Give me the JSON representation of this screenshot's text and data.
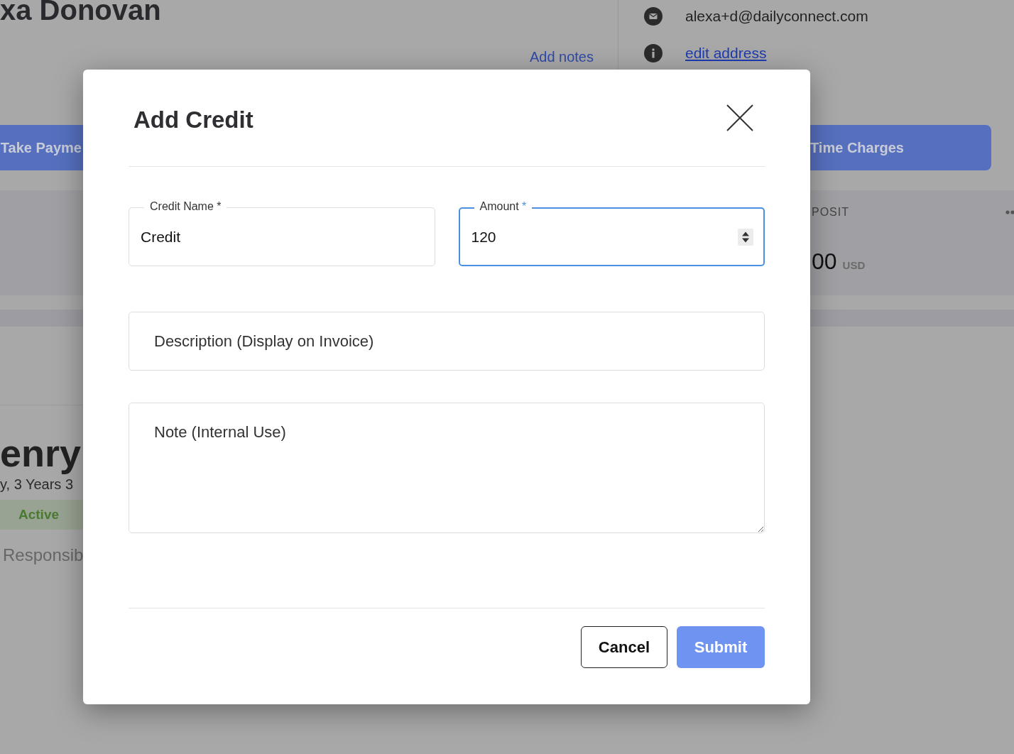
{
  "background": {
    "customer_name": "xa Donovan",
    "add_notes_link": "Add notes",
    "contacts": [
      {
        "kind": "email",
        "text": "alexa+d@dailyconnect.com"
      },
      {
        "kind": "info",
        "text": "edit address"
      }
    ],
    "take_payment_button": "Take Payme",
    "time_charges_button": "Time Charges",
    "deposit_card": {
      "label": "POSIT",
      "amount": "00",
      "currency": "USD"
    },
    "child": {
      "name": "enry",
      "age": "y, 3 Years 3",
      "status": "Active",
      "role": "Responsib"
    }
  },
  "dialog": {
    "title": "Add Credit",
    "fields": [
      {
        "kind": "text",
        "label": "Credit Name",
        "required_mark": "*",
        "value": "Credit",
        "focused": false
      },
      {
        "kind": "number",
        "label": "Amount",
        "required_mark": "*",
        "value": "120",
        "focused": true
      },
      {
        "kind": "text",
        "placeholder": "Description (Display on Invoice)"
      },
      {
        "kind": "textarea",
        "placeholder": "Note (Internal Use)"
      }
    ],
    "buttons": [
      {
        "kind": "secondary",
        "label": "Cancel"
      },
      {
        "kind": "primary",
        "label": "Submit"
      }
    ]
  }
}
